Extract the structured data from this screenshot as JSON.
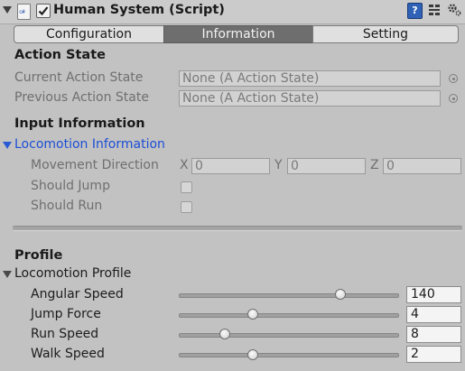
{
  "component": {
    "title": "Human System (Script)",
    "enabled": true,
    "script_icon_text": "c#",
    "ref_icon_text": "?"
  },
  "tabs": [
    {
      "label": "Configuration",
      "active": false
    },
    {
      "label": "Information",
      "active": true
    },
    {
      "label": "Setting",
      "active": false
    }
  ],
  "action_state": {
    "title": "Action State",
    "current_label": "Current Action State",
    "current_value": "None (A Action State)",
    "previous_label": "Previous Action State",
    "previous_value": "None (A Action State)"
  },
  "input_information": {
    "title": "Input Information",
    "foldout_label": "Locomotion Information",
    "movement_direction": {
      "label": "Movement Direction",
      "x_label": "X",
      "x_value": "0",
      "y_label": "Y",
      "y_value": "0",
      "z_label": "Z",
      "z_value": "0"
    },
    "should_jump_label": "Should Jump",
    "should_jump": false,
    "should_run_label": "Should Run",
    "should_run": false
  },
  "profile": {
    "title": "Profile",
    "foldout_label": "Locomotion Profile",
    "angular_speed": {
      "label": "Angular Speed",
      "value": "140",
      "fraction": 0.74
    },
    "jump_force": {
      "label": "Jump Force",
      "value": "4",
      "fraction": 0.34
    },
    "run_speed": {
      "label": "Run Speed",
      "value": "8",
      "fraction": 0.21
    },
    "walk_speed": {
      "label": "Walk Speed",
      "value": "2",
      "fraction": 0.34
    }
  },
  "colors": {
    "panel_bg": "#c2c2c2",
    "active_tab": "#6e6e6e",
    "foldout_blue": "#1d4fd6",
    "ref_icon": "#2f62b6"
  }
}
